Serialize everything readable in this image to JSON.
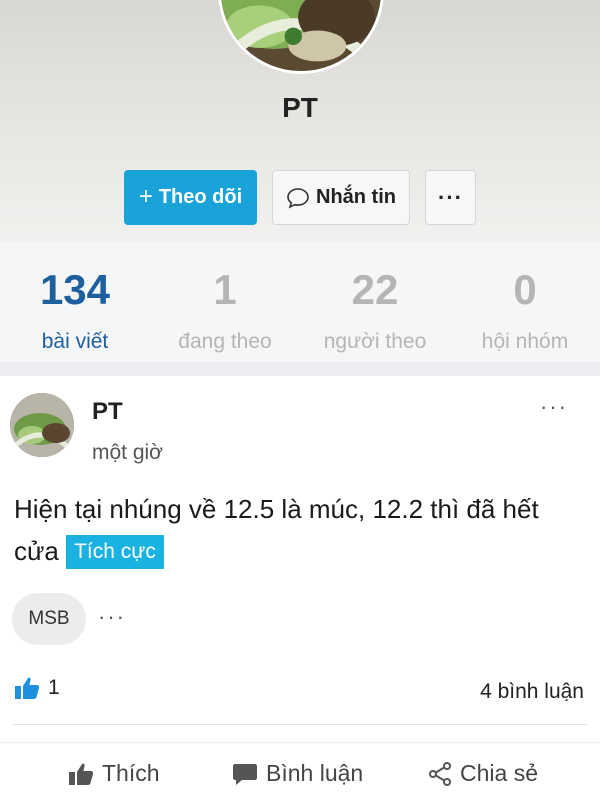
{
  "profile": {
    "name": "PT",
    "follow_label": "Theo dõi",
    "follow_plus": "+",
    "message_label": "Nhắn tin",
    "more_label": "···"
  },
  "stats": [
    {
      "value": "134",
      "label": "bài viết",
      "active": true
    },
    {
      "value": "1",
      "label": "đang theo",
      "active": false
    },
    {
      "value": "22",
      "label": "người theo",
      "active": false
    },
    {
      "value": "0",
      "label": "hội nhóm",
      "active": false
    }
  ],
  "post": {
    "author": "PT",
    "time": "một giờ",
    "menu": "···",
    "content": "Hiện tại nhúng về 12.5 là múc, 12.2 thì đã hết cửa",
    "sentiment": "Tích cực",
    "ticker": "MSB",
    "ticker_more": "···",
    "likes": "1",
    "comments": "4 bình luận"
  },
  "actions": {
    "like": "Thích",
    "comment": "Bình luận",
    "share": "Chia sẻ"
  },
  "colors": {
    "accent": "#1aa3d9",
    "stat_active": "#1e5f9e",
    "sentiment_bg": "#1ab2e0",
    "like_icon": "#1f8fe0"
  }
}
